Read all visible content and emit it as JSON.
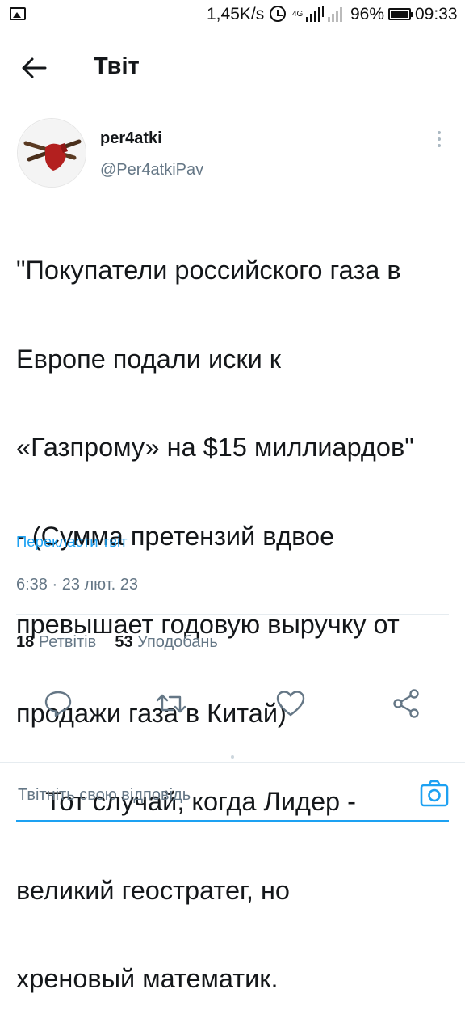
{
  "status_bar": {
    "network_speed": "1,45K/s",
    "network_type": "4G",
    "battery_percent": "96%",
    "battery_level": 0.96,
    "time": "09:33"
  },
  "header": {
    "title": "Твіт",
    "back_icon": "arrow-left-icon"
  },
  "tweet": {
    "author_name": "per4atki",
    "author_handle": "@Per4atkiPav",
    "text_lines": [
      "\"Покупатели российского газа в",
      "Европе подали иски к",
      "«Газпрому» на $15 миллиардов\"",
      "- (Сумма претензий вдвое",
      "превышает годовую выручку от",
      "продажи газа в Китай)",
      "    Тот случай, когда Лидер -",
      "великий геостратег, но",
      "хреновый математик."
    ],
    "translate_label": "Перекласти твіт",
    "timestamp": "6:38 · 23 лют. 23",
    "retweets_count": "18",
    "retweets_label": "Ретвітів",
    "likes_count": "53",
    "likes_label": "Уподобань"
  },
  "actions": {
    "reply_icon": "reply-icon",
    "retweet_icon": "retweet-icon",
    "like_icon": "heart-icon",
    "share_icon": "share-icon"
  },
  "compose": {
    "placeholder": "Твітніть свою відповідь",
    "camera_icon": "camera-icon"
  },
  "colors": {
    "accent": "#1da1f2",
    "text_primary": "#14171a",
    "text_secondary": "#657786",
    "divider": "#e6ecf0"
  }
}
